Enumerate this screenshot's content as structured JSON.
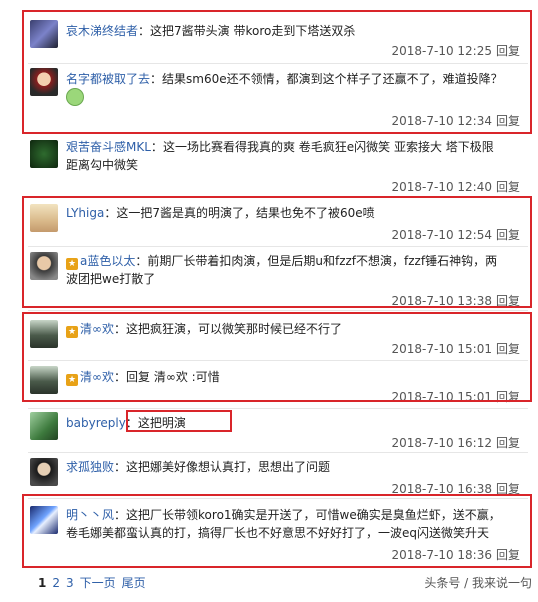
{
  "comments": [
    {
      "user": "哀木涕终结者",
      "text": "这把7酱带头演 带koro走到下塔送双杀",
      "time": "2018-7-10 12:25",
      "reply": "回复"
    },
    {
      "user": "名字都被取了去",
      "text": "结果sm60e还不领情，都演到这个样子了还赢不了，难道投降？",
      "time": "2018-7-10 12:34",
      "reply": "回复"
    },
    {
      "user": "艰苦奋斗感MKL",
      "text": "这一场比赛看得我真的爽 卷毛疯狂e闪微笑 亚索接大 塔下极限",
      "text2": "距离勾中微笑",
      "time": "2018-7-10 12:40",
      "reply": "回复"
    },
    {
      "user": "LYhiga",
      "text": "这一把7酱是真的明演了，结果也免不了被60e喷",
      "time": "2018-7-10 12:54",
      "reply": "回复"
    },
    {
      "user": "a蓝色以太",
      "text": "前期厂长带着扣肉演，但是后期u和fzzf不想演，fzzf锤石神钩，两",
      "text2": "波团把we打散了",
      "time": "2018-7-10 13:38",
      "reply": "回复"
    },
    {
      "user": "清∞欢",
      "text": "这把疯狂演，可以微笑那时候已经不行了",
      "time": "2018-7-10 15:01",
      "reply": "回复"
    },
    {
      "user": "清∞欢",
      "text": "回复 清∞欢 :可惜",
      "time": "2018-7-10 15:01",
      "reply": "回复"
    },
    {
      "user": "babyreply",
      "text": "这把明演",
      "time": "2018-7-10 16:12",
      "reply": "回复"
    },
    {
      "user": "求孤独败",
      "text": "这把娜美好像想认真打，思想出了问题",
      "time": "2018-7-10 16:38",
      "reply": "回复"
    },
    {
      "user": "明丶丶风",
      "text": "这把厂长带领koro1确实是开送了，可惜we确实是臭鱼烂虾，送不赢，",
      "text2": "卷毛娜美都蛮认真的打，搞得厂长也不好意思不好好打了，一波eq闪送微笑升天",
      "time": "2018-7-10 18:36",
      "reply": "回复"
    }
  ],
  "pager": {
    "p1": "1",
    "p2": "2",
    "p3": "3",
    "next": "下一页",
    "last": "尾页"
  },
  "watermark": "头条号 / 我来说一句",
  "colors": {
    "highlight": "#d9252a",
    "link": "#2e5fa8"
  }
}
